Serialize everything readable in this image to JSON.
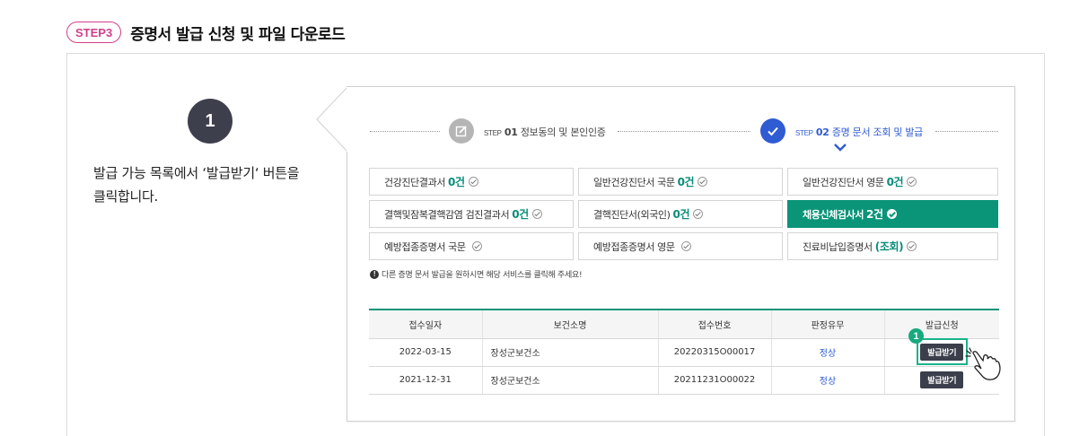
{
  "header": {
    "step_badge": "STEP3",
    "title": "증명서 발급 신청 및 파일 다운로드"
  },
  "guide": {
    "number": "1",
    "line1": "발급 가능 목록에서 ‘발급받기‘ 버튼을",
    "line2": "클릭합니다."
  },
  "stepper": {
    "step1": {
      "word": "STEP",
      "num": "01",
      "label": "정보동의 및 본인인증",
      "state": "done",
      "icon": "edit-icon"
    },
    "step2": {
      "word": "STEP",
      "num": "02",
      "label": "증명 문서 조회 및 발급",
      "state": "current",
      "icon": "check-icon"
    }
  },
  "doc_types": [
    {
      "label": "건강진단결과서",
      "count": "0건",
      "active": false
    },
    {
      "label": "일반건강진단서 국문",
      "count": "0건",
      "active": false
    },
    {
      "label": "일반건강진단서 영문",
      "count": "0건",
      "active": false
    },
    {
      "label": "결핵및잠복결핵감염 검진결과서",
      "count": "0건",
      "active": false
    },
    {
      "label": "결핵진단서(외국인)",
      "count": "0건",
      "active": false
    },
    {
      "label": "채용신체검사서",
      "count": "2건",
      "active": true
    },
    {
      "label": "예방접종증명서 국문",
      "count": "",
      "active": false
    },
    {
      "label": "예방접종증명서 영문",
      "count": "",
      "active": false
    },
    {
      "label": "진료비납입증명서",
      "count": "(조회)",
      "active": false
    }
  ],
  "notice": "다른 증명 문서 발급을 원하시면 해당 서비스를 클릭해 주세요!",
  "table": {
    "headers": [
      "접수일자",
      "보건소명",
      "접수번호",
      "판정유무",
      "발급신청"
    ],
    "rows": [
      {
        "date": "2022-03-15",
        "center": "장성군보건소",
        "number": "20220315O00017",
        "result": "정상",
        "action": "발급받기"
      },
      {
        "date": "2021-12-31",
        "center": "장성군보건소",
        "number": "20211231O00022",
        "result": "정상",
        "action": "발급받기"
      }
    ]
  },
  "highlight": {
    "number": "1"
  },
  "colors": {
    "accent_green": "#0a9478",
    "accent_blue": "#2f5bd3",
    "badge_pink": "#d0408a",
    "dark": "#3d3f4d"
  }
}
